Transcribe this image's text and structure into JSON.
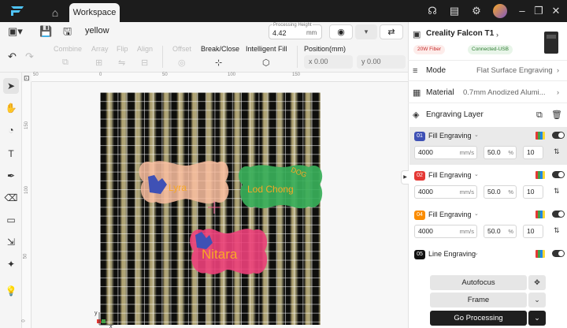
{
  "titlebar": {
    "tab_label": "Workspace",
    "icons": [
      "logo-icon",
      "home-icon",
      "support-icon",
      "clipboard-icon",
      "gear-icon",
      "avatar",
      "minimize-icon",
      "restore-icon",
      "close-icon"
    ]
  },
  "toolbar": {
    "project_name": "yellow",
    "processing_height_label": "Processing Height",
    "processing_height_value": "4.42",
    "processing_height_unit": "mm",
    "ops": {
      "combine": "Combine",
      "array": "Array",
      "flip": "Flip",
      "align": "Align",
      "offset": "Offset",
      "break_close": "Break/Close",
      "intelligent_fill": "Intelligent Fill"
    },
    "position_label": "Position(mm)",
    "x_value": "x 0.00",
    "y_value": "y 0.00"
  },
  "rulers": {
    "top": [
      "50",
      "0",
      "50",
      "100",
      "150"
    ],
    "left": [
      "150",
      "100",
      "50",
      "0"
    ]
  },
  "canvas": {
    "tag_labels": [
      "Lyra",
      "Lod Chong",
      "DOG",
      "Nitara"
    ],
    "axis_x": "x",
    "axis_y": "y"
  },
  "device": {
    "name": "Creality Falcon T1",
    "laser_badge": "20W Fiber",
    "status_badge": "Connected-USB",
    "status_color": "#2e7d32",
    "laser_color": "#c62828"
  },
  "settings": {
    "mode_label": "Mode",
    "mode_value": "Flat Surface Engraving",
    "material_label": "Material",
    "material_value": "0.7mm Anodized Alumi...",
    "layer_title": "Engraving Layer"
  },
  "layers": [
    {
      "num": "01",
      "name": "Fill Engraving",
      "color": "#3f51b5",
      "speed": "4000",
      "speed_unit": "mm/s",
      "power": "50.0",
      "power_unit": "%",
      "passes": "10"
    },
    {
      "num": "02",
      "name": "Fill Engraving",
      "color": "#e53935",
      "speed": "4000",
      "speed_unit": "mm/s",
      "power": "50.0",
      "power_unit": "%",
      "passes": "10"
    },
    {
      "num": "04",
      "name": "Fill Engraving",
      "color": "#fb8c00",
      "speed": "4000",
      "speed_unit": "mm/s",
      "power": "50.0",
      "power_unit": "%",
      "passes": "10"
    },
    {
      "num": "05",
      "name": "Line Engraving",
      "color": "#111111",
      "speed": "",
      "speed_unit": "",
      "power": "",
      "power_unit": "",
      "passes": ""
    }
  ],
  "actions": {
    "autofocus": "Autofocus",
    "frame": "Frame",
    "go": "Go Processing"
  }
}
